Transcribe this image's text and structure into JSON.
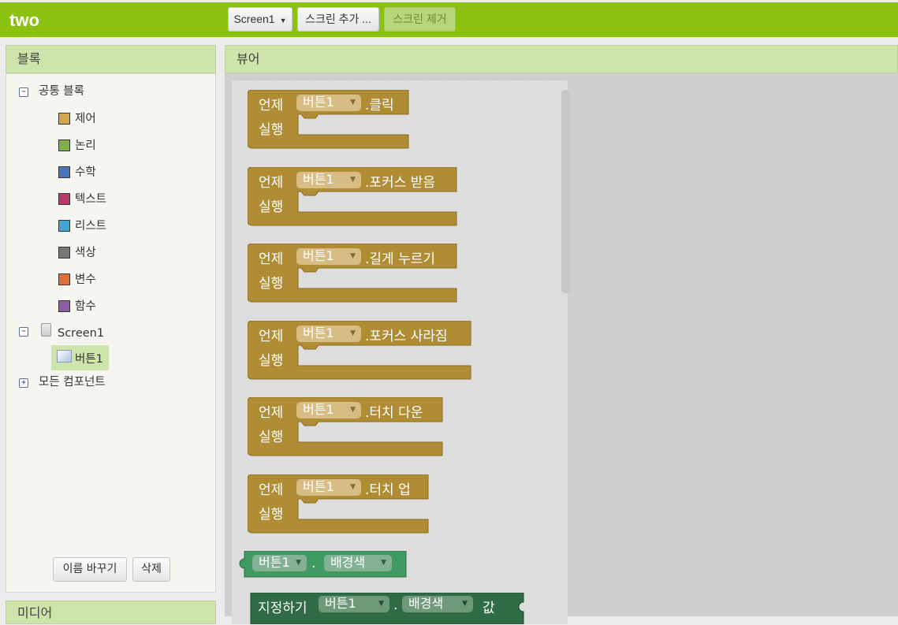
{
  "topbar": {
    "app_title": "two",
    "screen_select": "Screen1",
    "add_screen": "스크린 추가 ...",
    "remove_screen": "스크린 제거"
  },
  "blocks_panel": {
    "title": "블록",
    "builtin_label": "공통 블록",
    "categories": [
      {
        "label": "제어",
        "color": "#d4a84a"
      },
      {
        "label": "논리",
        "color": "#7fb04c"
      },
      {
        "label": "수학",
        "color": "#4a74b8"
      },
      {
        "label": "텍스트",
        "color": "#b83a6a"
      },
      {
        "label": "리스트",
        "color": "#43a5d2"
      },
      {
        "label": "색상",
        "color": "#777777"
      },
      {
        "label": "변수",
        "color": "#e0703a"
      },
      {
        "label": "함수",
        "color": "#8f5ea0"
      }
    ],
    "screen_label": "Screen1",
    "component_label": "버튼1",
    "all_components_label": "모든 컴포넌트",
    "rename_button": "이름 바꾸기",
    "delete_button": "삭제",
    "next_panel_title": "미디어"
  },
  "viewer": {
    "title": "뷰어",
    "when_label": "언제",
    "do_label": "실행",
    "component": "버튼1",
    "events": [
      {
        "event": ".클릭"
      },
      {
        "event": ".포커스 받음"
      },
      {
        "event": ".길게 누르기"
      },
      {
        "event": ".포커스 사라짐"
      },
      {
        "event": ".터치 다운"
      },
      {
        "event": ".터치 업"
      }
    ],
    "getter": {
      "component": "버튼1",
      "dot": ".",
      "property": "배경색"
    },
    "setter": {
      "set_label": "지정하기",
      "component": "버튼1",
      "dot": ".",
      "property": "배경색",
      "to_label": "값"
    }
  },
  "colors": {
    "topbar": "#8bc10f",
    "event_block": "#b08d34",
    "getter_block": "#3f9a62",
    "setter_block": "#2f6b45"
  }
}
